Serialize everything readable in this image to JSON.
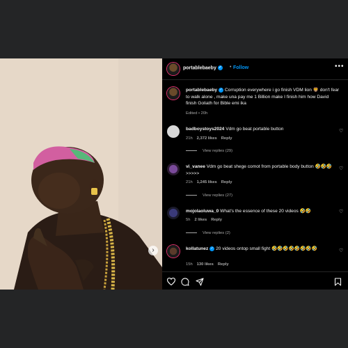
{
  "post": {
    "username": "portablebaeby",
    "follow_label": "Follow",
    "more_label": "•••",
    "caption": "Corruption everywhere i go finish VDM lion 🦁 don't fear to walk alone , make una pay me 1 Billion make I finish him how David finish Goliath for Bible emi ika",
    "edited": "Edited • 20h"
  },
  "comments": [
    {
      "username": "badboystoys2024",
      "text": "Vdm go beat portable button",
      "time": "21h",
      "likes": "2,372 likes",
      "reply": "Reply",
      "view_replies": "View replies (29)"
    },
    {
      "username": "vi_vanee",
      "text": "Vdm go beat shege comot from portable body button 🤣🤣🤣>>>>>",
      "time": "21h",
      "likes": "1,245 likes",
      "reply": "Reply",
      "view_replies": "View replies (27)"
    },
    {
      "username": "mojolaoluwa_0",
      "text": "What's the essence of these 20 videos 🤣🤣",
      "time": "5h",
      "likes": "2 likes",
      "reply": "Reply",
      "view_replies": "View replies (2)"
    },
    {
      "username": "kollatunez",
      "text": "20 videos ontop small fight 🤣🤣🤣🤣🤣🤣🤣🤣",
      "time": "15h",
      "likes": "130 likes",
      "reply": "Reply"
    }
  ],
  "icons": {
    "like": "heart-icon",
    "comment": "comment-icon",
    "share": "share-icon",
    "save": "bookmark-icon",
    "next": "chevron-right-icon"
  },
  "colors": {
    "background": "#242526",
    "panel": "#000000",
    "accent": "#0095f6"
  }
}
